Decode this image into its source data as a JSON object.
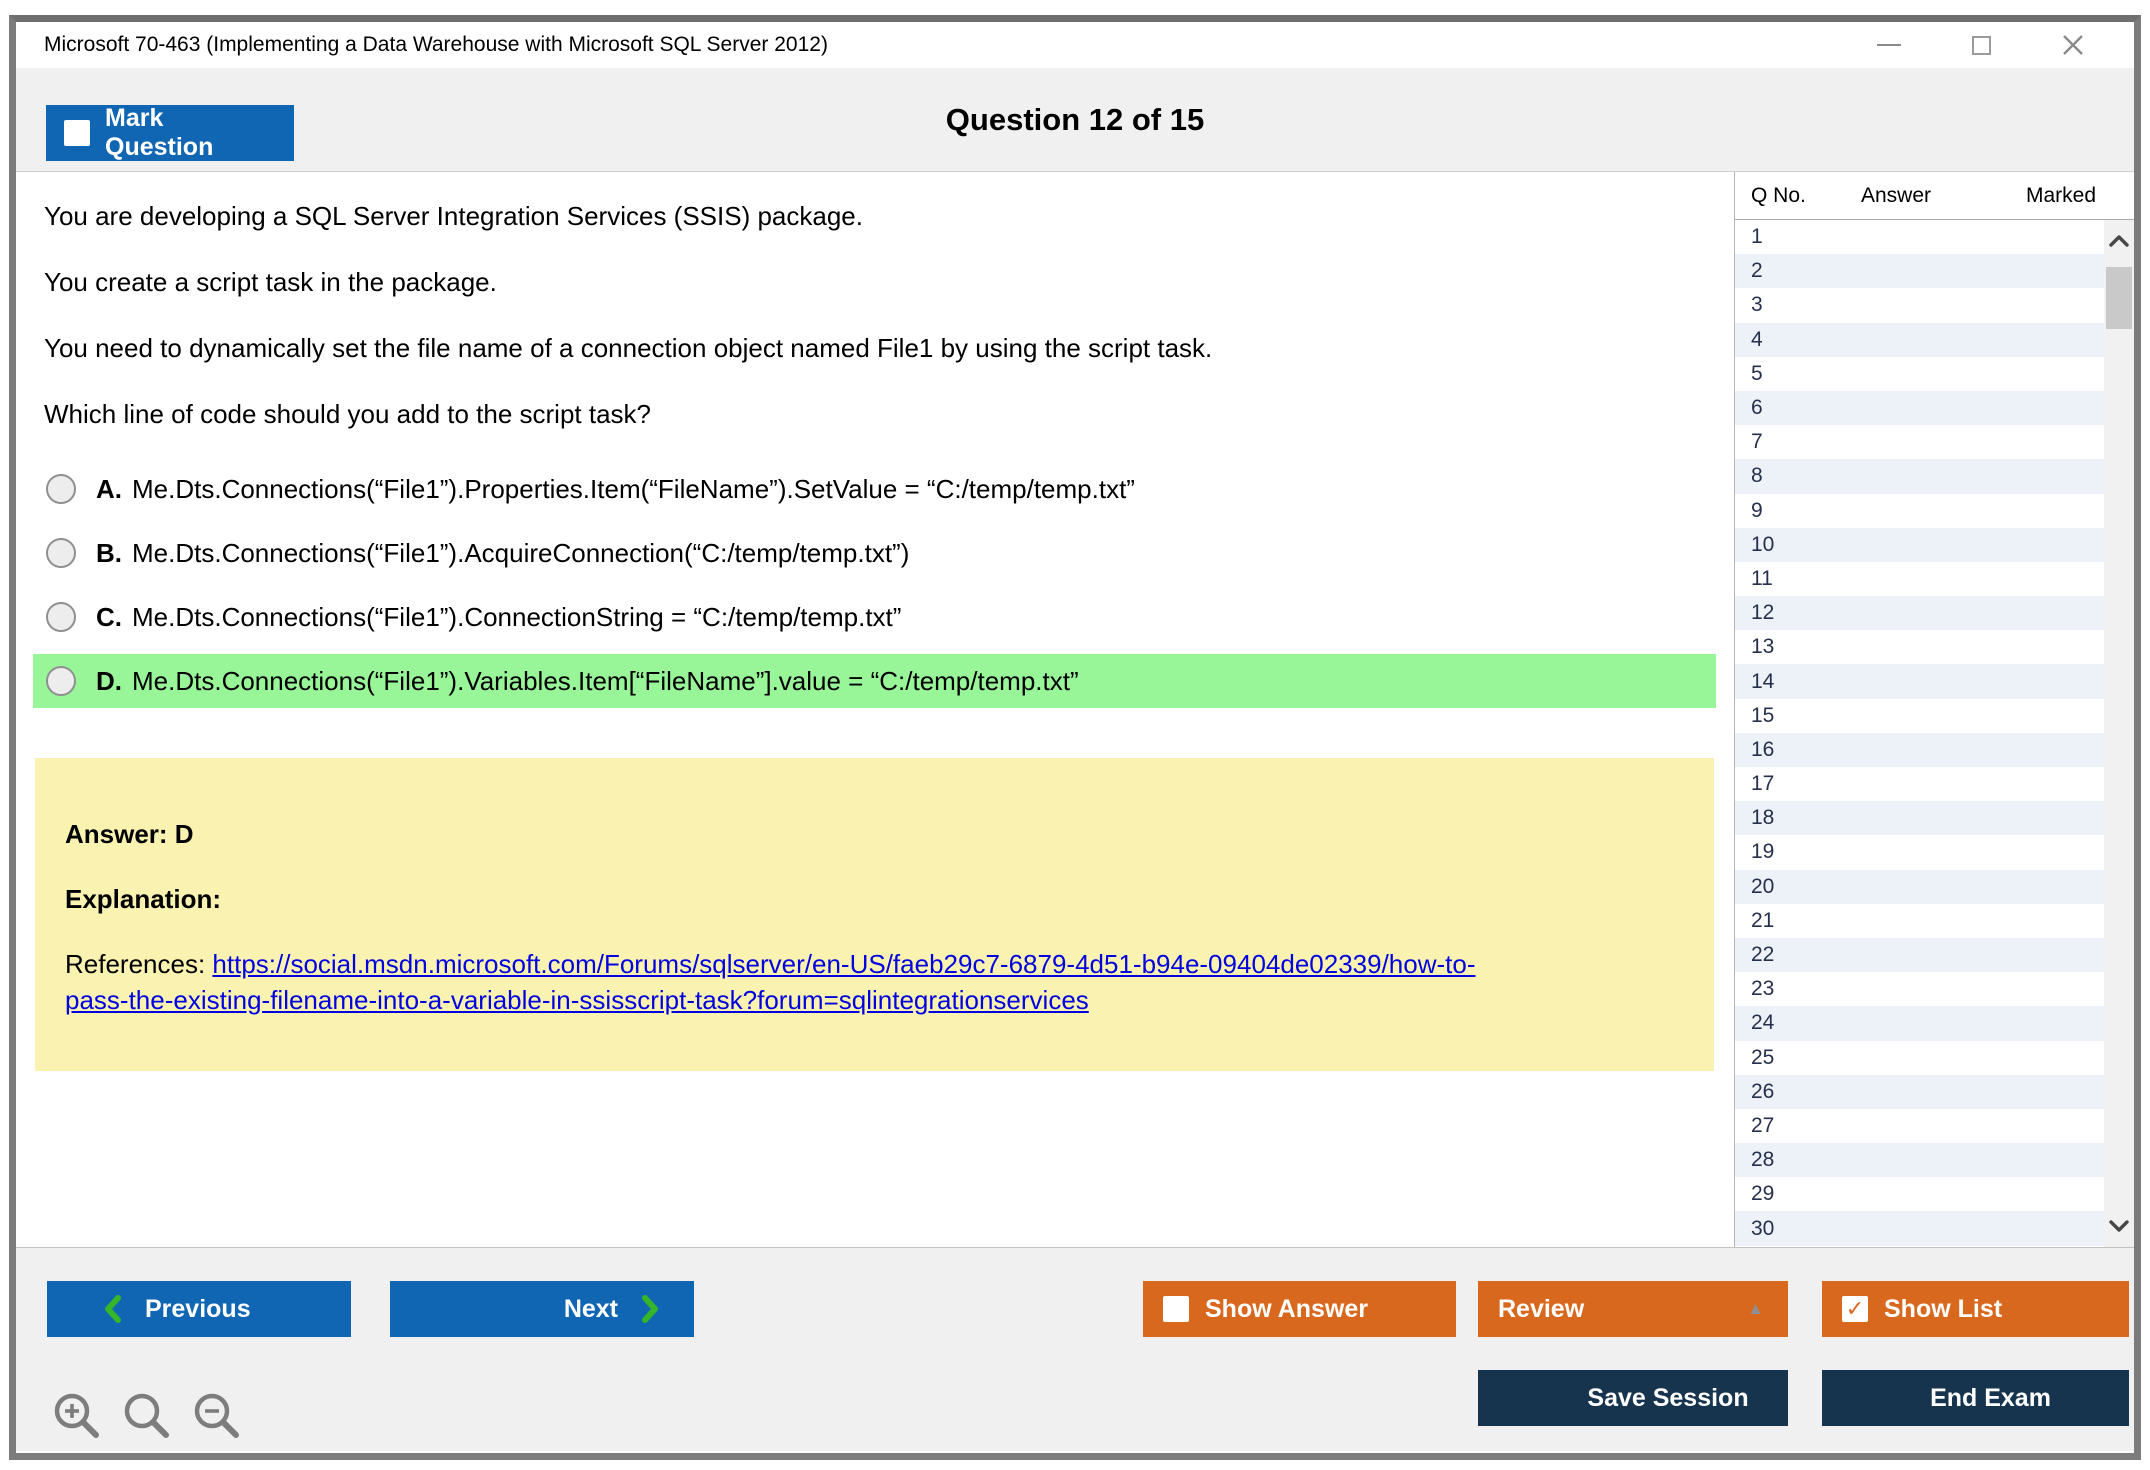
{
  "window": {
    "title": "Microsoft 70-463 (Implementing a Data Warehouse with Microsoft SQL Server 2012)"
  },
  "header": {
    "mark_question_label": "Mark Question",
    "question_counter": "Question 12 of 15"
  },
  "question": {
    "paragraphs": [
      "You are developing a SQL Server Integration Services (SSIS) package.",
      "You create a script task in the package.",
      "You need to dynamically set the file name of a connection object named File1 by using the script task.",
      "Which line of code should you add to the script task?"
    ],
    "options": [
      {
        "letter": "A.",
        "text": "Me.Dts.Connections(“File1”).Properties.Item(“FileName”).SetValue = “C:/temp/temp.txt”",
        "highlighted": false
      },
      {
        "letter": "B.",
        "text": "Me.Dts.Connections(“File1”).AcquireConnection(“C:/temp/temp.txt”)",
        "highlighted": false
      },
      {
        "letter": "C.",
        "text": "Me.Dts.Connections(“File1”).ConnectionString = “C:/temp/temp.txt”",
        "highlighted": false
      },
      {
        "letter": "D.",
        "text": "Me.Dts.Connections(“File1”).Variables.Item[“FileName”].value = “C:/temp/temp.txt”",
        "highlighted": true
      }
    ]
  },
  "answer_box": {
    "answer": "Answer: D",
    "explanation": "Explanation:",
    "references_label": "References: ",
    "link_line1": "https://social.msdn.microsoft.com/Forums/sqlserver/en-US/faeb29c7-6879-4d51-b94e-09404de02339/how-to-",
    "link_line2": "pass-the-existing-filename-into-a-variable-in-ssisscript-task?forum=sqlintegrationservices"
  },
  "sidebar": {
    "columns": [
      "Q No.",
      "Answer",
      "Marked"
    ],
    "rows": [
      "1",
      "2",
      "3",
      "4",
      "5",
      "6",
      "7",
      "8",
      "9",
      "10",
      "11",
      "12",
      "13",
      "14",
      "15",
      "16",
      "17",
      "18",
      "19",
      "20",
      "21",
      "22",
      "23",
      "24",
      "25",
      "26",
      "27",
      "28",
      "29",
      "30"
    ]
  },
  "footer": {
    "previous": "Previous",
    "next": "Next",
    "show_answer": "Show Answer",
    "review": "Review",
    "show_list": "Show List",
    "save_session": "Save Session",
    "end_exam": "End Exam"
  },
  "colors": {
    "accent_blue": "#1066b2",
    "accent_orange": "#d9681f",
    "accent_navy": "#17344f",
    "highlight_green": "#98f698",
    "note_yellow": "#faf2b0",
    "link_blue": "#0202e0",
    "row_alt_blue": "#edf2f8",
    "chevron_green": "#35b52a"
  }
}
